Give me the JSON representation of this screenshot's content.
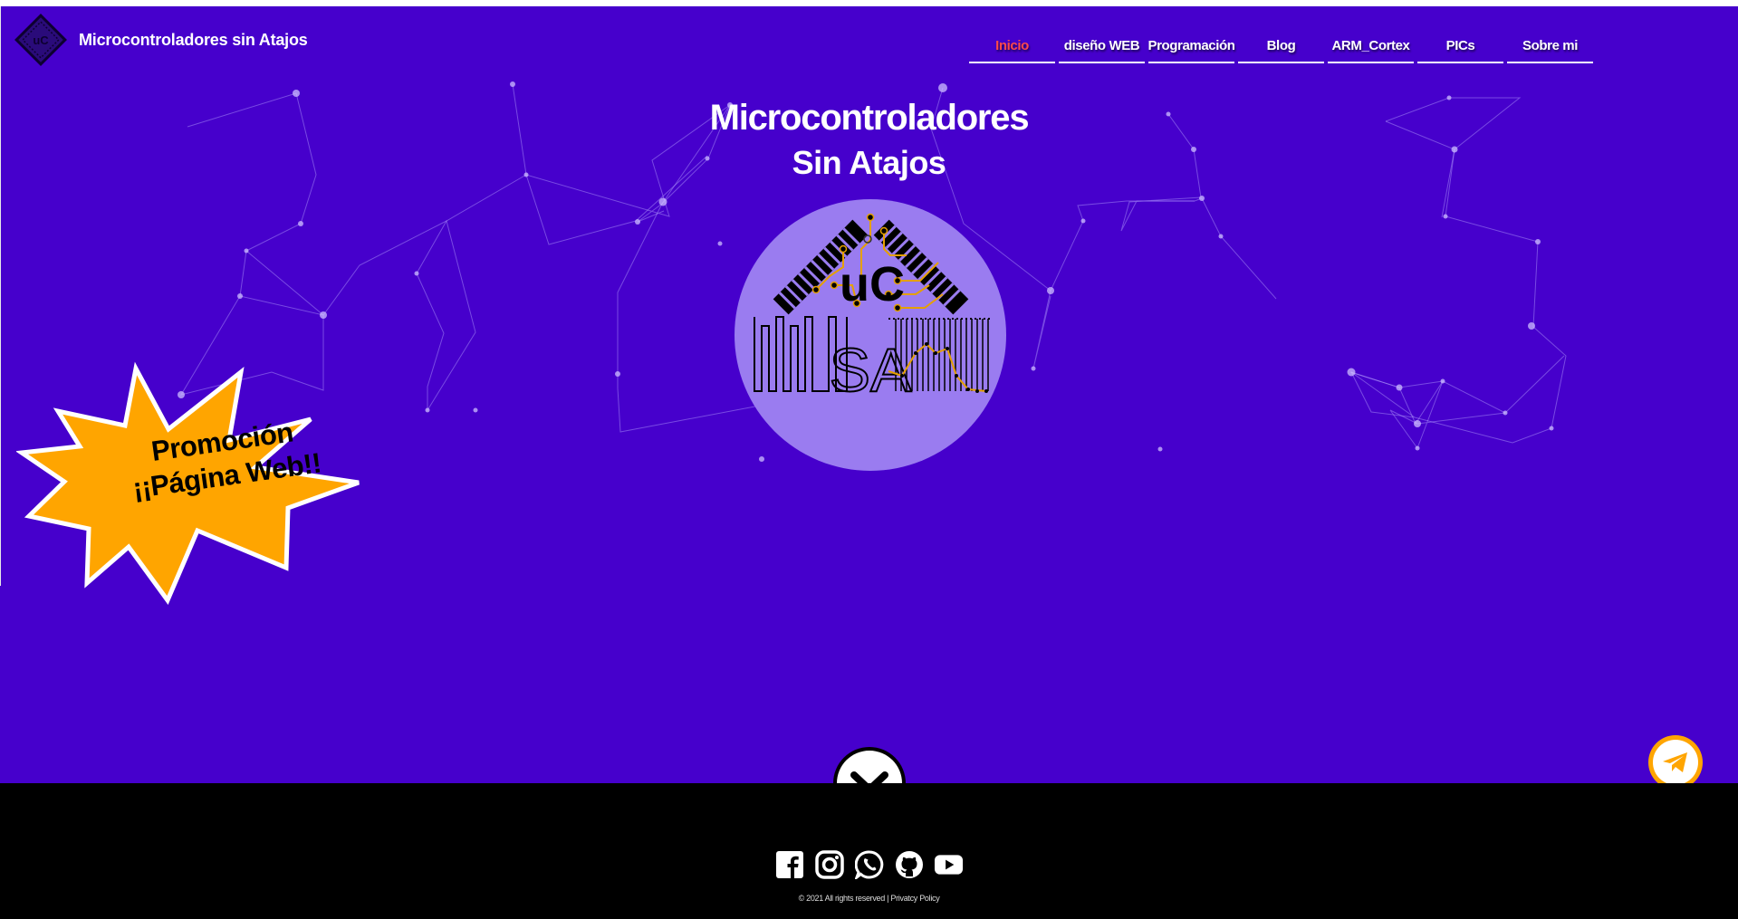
{
  "site": {
    "title": "Microcontroladores sin Atajos",
    "logo_icon": "uc-logo-icon",
    "logo_text": "uC"
  },
  "nav": {
    "items": [
      {
        "label": "Inicio",
        "active": true
      },
      {
        "label": "diseño WEB",
        "active": false
      },
      {
        "label": "Programación",
        "active": false
      },
      {
        "label": "Blog",
        "active": false
      },
      {
        "label": "ARM_Cortex",
        "active": false
      },
      {
        "label": "PICs",
        "active": false
      },
      {
        "label": "Sobre mi",
        "active": false
      }
    ]
  },
  "hero": {
    "title_line1": "Microcontroladores",
    "title_line2": "Sin Atajos",
    "logo_top": "uC",
    "logo_bottom": "SA"
  },
  "promo": {
    "line1": "Promoción",
    "line2": "¡¡Página Web!!"
  },
  "footer": {
    "socials": [
      "facebook-icon",
      "instagram-icon",
      "whatsapp-icon",
      "github-icon",
      "youtube-icon"
    ],
    "copyright": "© 2021 All rights reserved |",
    "privacy": "Privatcy Policy"
  },
  "colors": {
    "hero_bg": "#4600cc",
    "active_nav": "#ff4a4a",
    "promo_fill": "#ffa500",
    "circle_fill": "#9a7cf0",
    "circuit_trace": "#e5a000"
  }
}
